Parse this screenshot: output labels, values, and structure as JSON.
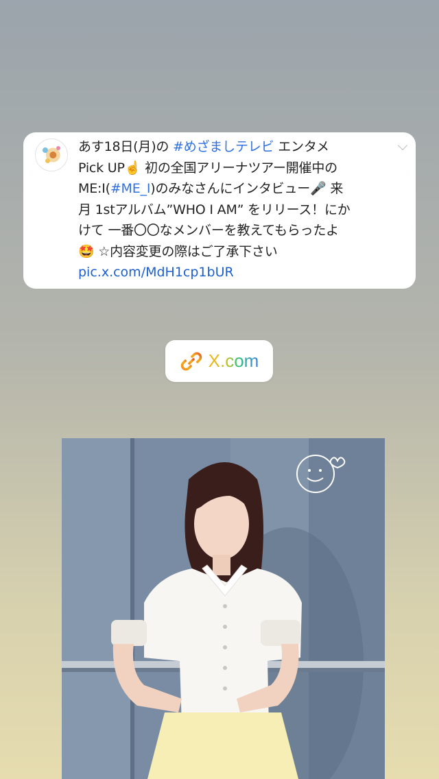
{
  "tweet": {
    "lines": [
      {
        "before": "あす18日(月)の ",
        "link": "#めざましテレビ",
        "after": " エンタメ"
      },
      {
        "before": "Pick UP☝️ 初の全国アリーナツアー開催中の",
        "link": "",
        "after": ""
      },
      {
        "before": "ME:I(",
        "link": "#ME_I",
        "after": ")のみなさんにインタビュー🎤 来"
      },
      {
        "before": "月 1stアルバム”WHO I AM” をリリース！にか",
        "link": "",
        "after": ""
      },
      {
        "before": "けて 一番〇〇なメンバーを教えてもらったよ",
        "link": "",
        "after": ""
      },
      {
        "before": "🤩 ☆内容変更の際はご了承下さい",
        "link": "",
        "after": ""
      }
    ],
    "url": "pic.x.com/MdH1cp1bUR"
  },
  "link_sticker": {
    "label": "X.com",
    "icon": "link-icon"
  },
  "colors": {
    "hashtag": "#2f6fe0",
    "url": "#1c5fd0"
  }
}
